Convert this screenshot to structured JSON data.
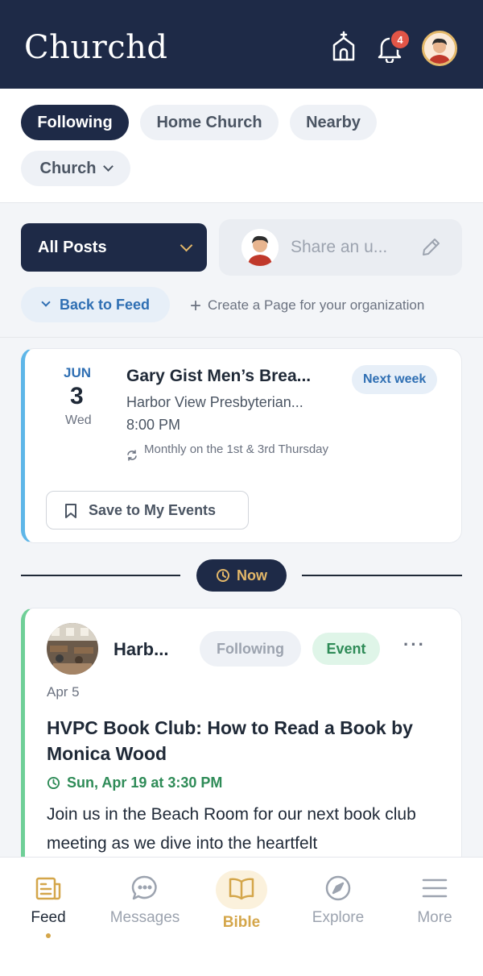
{
  "header": {
    "logo": "Churchd",
    "notification_count": "4",
    "icons": [
      "church-icon",
      "bell-icon",
      "avatar"
    ],
    "colors": {
      "background": "#1e2a47",
      "accent": "#e4b869",
      "badge": "#e25547"
    }
  },
  "filters": {
    "chips": [
      {
        "label": "Following",
        "active": true
      },
      {
        "label": "Home Church",
        "active": false
      },
      {
        "label": "Nearby",
        "active": false
      },
      {
        "label": "Church",
        "active": false,
        "has_dropdown": true
      }
    ]
  },
  "controls": {
    "posts_select": "All Posts",
    "share_placeholder": "Share an u...",
    "back_to_feed": "Back to Feed",
    "create_page": "Create a Page for your organization"
  },
  "event": {
    "month": "JUN",
    "day": "3",
    "weekday": "Wed",
    "title": "Gary Gist Men’s Brea...",
    "organization": "Harbor View Presbyterian...",
    "time": "8:00 PM",
    "recurrence": "Monthly on the 1st & 3rd Thursday",
    "badge": "Next week",
    "save_label": "Save to My Events",
    "accent_color": "#5eb6e8"
  },
  "separator": {
    "label": "Now"
  },
  "post": {
    "org": "Harb...",
    "following_label": "Following",
    "type_label": "Event",
    "more_label": "···",
    "date": "Apr 5",
    "title": "HVPC Book Club: How to Read a Book by Monica Wood",
    "when": "Sun, Apr 19 at 3:30 PM",
    "body": "Join us in the Beach Room for our next book club meeting as we dive into the heartfelt",
    "accent_color": "#6fcf97"
  },
  "nav": {
    "items": [
      {
        "label": "Feed",
        "icon": "feed-icon",
        "active": true
      },
      {
        "label": "Messages",
        "icon": "messages-icon",
        "active": false
      },
      {
        "label": "Bible",
        "icon": "bible-icon",
        "active": false
      },
      {
        "label": "Explore",
        "icon": "compass-icon",
        "active": false
      },
      {
        "label": "More",
        "icon": "menu-icon",
        "active": false
      }
    ]
  }
}
